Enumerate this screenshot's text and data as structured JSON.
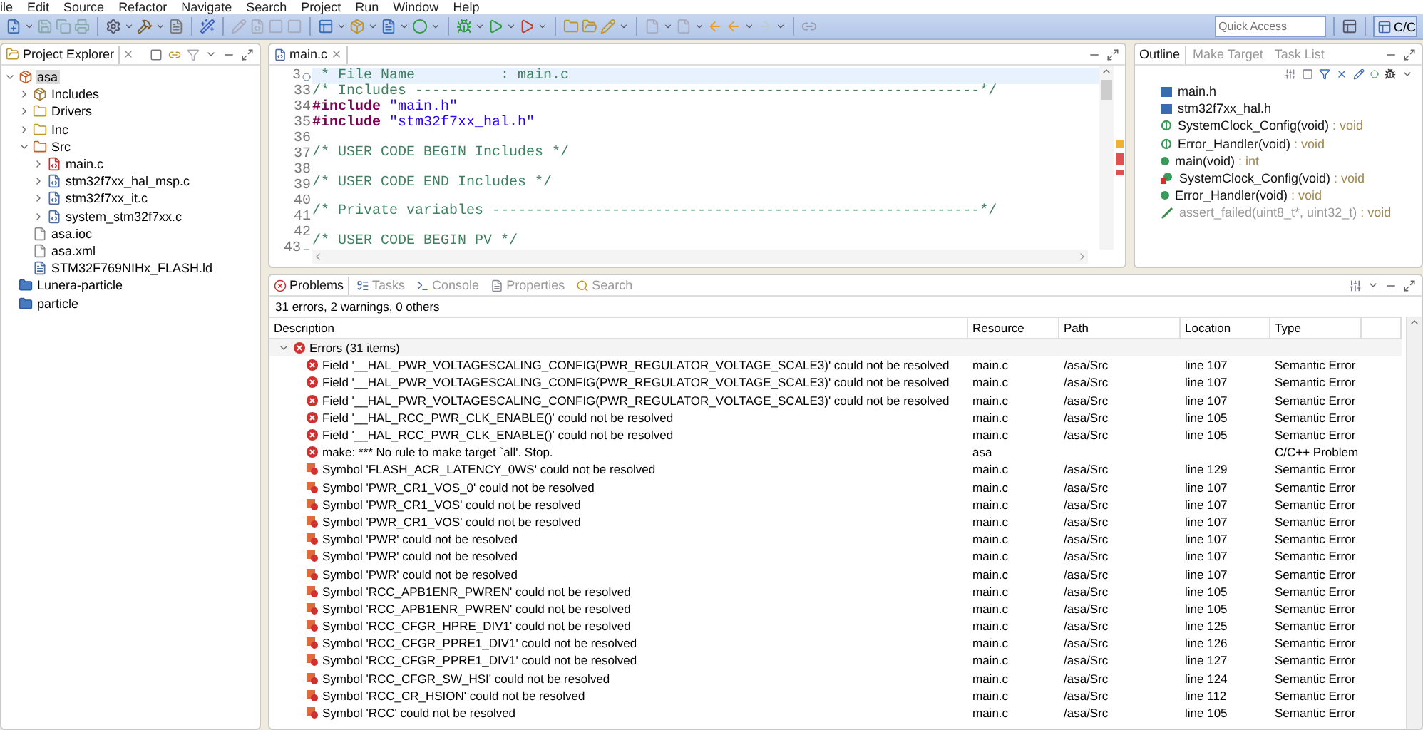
{
  "menu": [
    "ile",
    "Edit",
    "Source",
    "Refactor",
    "Navigate",
    "Search",
    "Project",
    "Run",
    "Window",
    "Help"
  ],
  "quick_access": {
    "placeholder": "Quick Access"
  },
  "perspective": {
    "label": "C/C",
    "selected": true
  },
  "explorer": {
    "title": "Project Explorer",
    "tree": [
      {
        "label": "asa",
        "kind": "project",
        "expanded": true,
        "selected": true,
        "children": [
          {
            "label": "Includes",
            "kind": "includes",
            "expanded": false,
            "selected": false
          },
          {
            "label": "Drivers",
            "kind": "folder",
            "expanded": false,
            "selected": false
          },
          {
            "label": "Inc",
            "kind": "folder",
            "expanded": false,
            "selected": false
          },
          {
            "label": "Src",
            "kind": "srcfolder",
            "expanded": true,
            "selected": false,
            "children": [
              {
                "label": "main.c",
                "kind": "cerror",
                "expanded": false,
                "selected": false
              },
              {
                "label": "stm32f7xx_hal_msp.c",
                "kind": "cfile",
                "expanded": false,
                "selected": false
              },
              {
                "label": "stm32f7xx_it.c",
                "kind": "cfile",
                "expanded": false,
                "selected": false
              },
              {
                "label": "system_stm32f7xx.c",
                "kind": "cfile",
                "expanded": false,
                "selected": false
              }
            ]
          },
          {
            "label": "asa.ioc",
            "kind": "file",
            "selected": false
          },
          {
            "label": "asa.xml",
            "kind": "file",
            "selected": false
          },
          {
            "label": "STM32F769NIHx_FLASH.ld",
            "kind": "ldfile",
            "selected": false
          }
        ]
      },
      {
        "label": "Lunera-particle",
        "kind": "closedproject",
        "selected": false
      },
      {
        "label": "particle",
        "kind": "closedproject",
        "selected": false
      }
    ]
  },
  "editor": {
    "tab": "main.c",
    "lines": [
      {
        "number": "3",
        "folded": true,
        "current": true,
        "parts": [
          {
            "kind": "comment",
            "text": " * File Name          : main.c"
          }
        ]
      },
      {
        "number": "33",
        "parts": [
          {
            "kind": "comment",
            "text": "/* Includes ------------------------------------------------------------------*/"
          }
        ]
      },
      {
        "number": "34",
        "parts": [
          {
            "kind": "directive",
            "text": "#include "
          },
          {
            "kind": "string",
            "text": "\"main.h\""
          }
        ]
      },
      {
        "number": "35",
        "parts": [
          {
            "kind": "directive",
            "text": "#include "
          },
          {
            "kind": "string",
            "text": "\"stm32f7xx_hal.h\""
          }
        ]
      },
      {
        "number": "36"
      },
      {
        "number": "37",
        "parts": [
          {
            "kind": "comment",
            "text": "/* USER CODE BEGIN Includes */"
          }
        ]
      },
      {
        "number": "38"
      },
      {
        "number": "39",
        "parts": [
          {
            "kind": "comment",
            "text": "/* USER CODE END Includes */"
          }
        ]
      },
      {
        "number": "40"
      },
      {
        "number": "41",
        "parts": [
          {
            "kind": "comment",
            "text": "/* Private variables ---------------------------------------------------------*/"
          }
        ]
      },
      {
        "number": "42"
      },
      {
        "number": "43",
        "folded": false,
        "parts": [
          {
            "kind": "comment",
            "text": "/* USER CODE BEGIN PV */"
          }
        ]
      }
    ]
  },
  "outline": {
    "tabs": [
      {
        "label": "Outline",
        "selected": true
      },
      {
        "label": "Make Target",
        "selected": false
      },
      {
        "label": "Task List",
        "selected": false
      }
    ],
    "items": [
      {
        "name": "main.h",
        "kind": "include"
      },
      {
        "name": "stm32f7xx_hal.h",
        "kind": "include"
      },
      {
        "name": "SystemClock_Config(void)",
        "type": " : void",
        "kind": "declaration"
      },
      {
        "name": "Error_Handler(void)",
        "type": " : void",
        "kind": "declaration"
      },
      {
        "name": "main(void)",
        "type": " : int",
        "kind": "function"
      },
      {
        "name": "SystemClock_Config(void)",
        "type": " : void",
        "kind": "static"
      },
      {
        "name": "Error_Handler(void)",
        "type": " : void",
        "kind": "function"
      },
      {
        "name": "assert_failed(uint8_t*, uint32_t)",
        "type": " : void",
        "kind": "inactive"
      }
    ]
  },
  "problems": {
    "tabs": [
      {
        "label": "Problems",
        "selected": true
      },
      {
        "label": "Tasks",
        "selected": false
      },
      {
        "label": "Console",
        "selected": false
      },
      {
        "label": "Properties",
        "selected": false
      },
      {
        "label": "Search",
        "selected": false
      }
    ],
    "summary": "31 errors, 2 warnings, 0 others",
    "columns": [
      "Description",
      "Resource",
      "Path",
      "Location",
      "Type"
    ],
    "group": {
      "label": "Errors (31 items)",
      "expanded": true
    },
    "rows": [
      {
        "kind": "error",
        "description": "Field '__HAL_PWR_VOLTAGESCALING_CONFIG(PWR_REGULATOR_VOLTAGE_SCALE3)' could not be resolved",
        "resource": "main.c",
        "path": "/asa/Src",
        "location": "line 107",
        "type": "Semantic Error"
      },
      {
        "kind": "error",
        "description": "Field '__HAL_PWR_VOLTAGESCALING_CONFIG(PWR_REGULATOR_VOLTAGE_SCALE3)' could not be resolved",
        "resource": "main.c",
        "path": "/asa/Src",
        "location": "line 107",
        "type": "Semantic Error"
      },
      {
        "kind": "error",
        "description": "Field '__HAL_PWR_VOLTAGESCALING_CONFIG(PWR_REGULATOR_VOLTAGE_SCALE3)' could not be resolved",
        "resource": "main.c",
        "path": "/asa/Src",
        "location": "line 107",
        "type": "Semantic Error"
      },
      {
        "kind": "error",
        "description": "Field '__HAL_RCC_PWR_CLK_ENABLE()' could not be resolved",
        "resource": "main.c",
        "path": "/asa/Src",
        "location": "line 105",
        "type": "Semantic Error"
      },
      {
        "kind": "error",
        "description": "Field '__HAL_RCC_PWR_CLK_ENABLE()' could not be resolved",
        "resource": "main.c",
        "path": "/asa/Src",
        "location": "line 105",
        "type": "Semantic Error"
      },
      {
        "kind": "error",
        "description": "make: *** No rule to make target `all'.  Stop.",
        "resource": "asa",
        "type": "C/C++ Problem"
      },
      {
        "kind": "symbol",
        "description": "Symbol 'FLASH_ACR_LATENCY_0WS' could not be resolved",
        "resource": "main.c",
        "path": "/asa/Src",
        "location": "line 129",
        "type": "Semantic Error"
      },
      {
        "kind": "symbol",
        "description": "Symbol 'PWR_CR1_VOS_0' could not be resolved",
        "resource": "main.c",
        "path": "/asa/Src",
        "location": "line 107",
        "type": "Semantic Error"
      },
      {
        "kind": "symbol",
        "description": "Symbol 'PWR_CR1_VOS' could not be resolved",
        "resource": "main.c",
        "path": "/asa/Src",
        "location": "line 107",
        "type": "Semantic Error"
      },
      {
        "kind": "symbol",
        "description": "Symbol 'PWR_CR1_VOS' could not be resolved",
        "resource": "main.c",
        "path": "/asa/Src",
        "location": "line 107",
        "type": "Semantic Error"
      },
      {
        "kind": "symbol",
        "description": "Symbol 'PWR' could not be resolved",
        "resource": "main.c",
        "path": "/asa/Src",
        "location": "line 107",
        "type": "Semantic Error"
      },
      {
        "kind": "symbol",
        "description": "Symbol 'PWR' could not be resolved",
        "resource": "main.c",
        "path": "/asa/Src",
        "location": "line 107",
        "type": "Semantic Error"
      },
      {
        "kind": "symbol",
        "description": "Symbol 'PWR' could not be resolved",
        "resource": "main.c",
        "path": "/asa/Src",
        "location": "line 107",
        "type": "Semantic Error"
      },
      {
        "kind": "symbol",
        "description": "Symbol 'RCC_APB1ENR_PWREN' could not be resolved",
        "resource": "main.c",
        "path": "/asa/Src",
        "location": "line 105",
        "type": "Semantic Error"
      },
      {
        "kind": "symbol",
        "description": "Symbol 'RCC_APB1ENR_PWREN' could not be resolved",
        "resource": "main.c",
        "path": "/asa/Src",
        "location": "line 105",
        "type": "Semantic Error"
      },
      {
        "kind": "symbol",
        "description": "Symbol 'RCC_CFGR_HPRE_DIV1' could not be resolved",
        "resource": "main.c",
        "path": "/asa/Src",
        "location": "line 125",
        "type": "Semantic Error"
      },
      {
        "kind": "symbol",
        "description": "Symbol 'RCC_CFGR_PPRE1_DIV1' could not be resolved",
        "resource": "main.c",
        "path": "/asa/Src",
        "location": "line 126",
        "type": "Semantic Error"
      },
      {
        "kind": "symbol",
        "description": "Symbol 'RCC_CFGR_PPRE1_DIV1' could not be resolved",
        "resource": "main.c",
        "path": "/asa/Src",
        "location": "line 127",
        "type": "Semantic Error"
      },
      {
        "kind": "symbol",
        "description": "Symbol 'RCC_CFGR_SW_HSI' could not be resolved",
        "resource": "main.c",
        "path": "/asa/Src",
        "location": "line 124",
        "type": "Semantic Error"
      },
      {
        "kind": "symbol",
        "description": "Symbol 'RCC_CR_HSION' could not be resolved",
        "resource": "main.c",
        "path": "/asa/Src",
        "location": "line 112",
        "type": "Semantic Error"
      },
      {
        "kind": "symbol",
        "description": "Symbol 'RCC' could not be resolved",
        "resource": "main.c",
        "path": "/asa/Src",
        "location": "line 105",
        "type": "Semantic Error"
      }
    ]
  }
}
